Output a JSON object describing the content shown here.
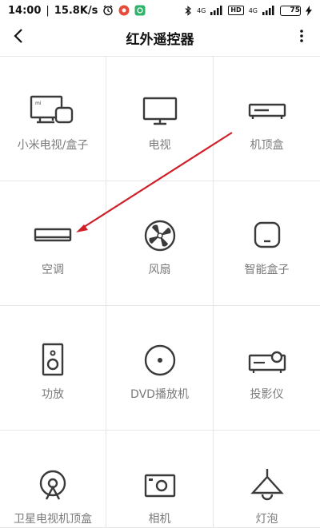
{
  "status_bar": {
    "time": "14:00",
    "net_speed": "15.8K/s",
    "tags": [
      "4G",
      "HD",
      "4G"
    ],
    "battery": "75",
    "battery_color": "#b7e44a"
  },
  "app_bar": {
    "title": "红外遥控器",
    "back_icon": "back-chevron-icon",
    "more_icon": "more-vertical-icon"
  },
  "devices": [
    {
      "label": "小米电视/盒子",
      "icon": "mi-tv-box-icon"
    },
    {
      "label": "电视",
      "icon": "tv-icon"
    },
    {
      "label": "机顶盒",
      "icon": "set-top-box-icon"
    },
    {
      "label": "空调",
      "icon": "air-conditioner-icon"
    },
    {
      "label": "风扇",
      "icon": "fan-icon"
    },
    {
      "label": "智能盒子",
      "icon": "smart-box-icon"
    },
    {
      "label": "功放",
      "icon": "amplifier-icon"
    },
    {
      "label": "DVD播放机",
      "icon": "dvd-player-icon"
    },
    {
      "label": "投影仪",
      "icon": "projector-icon"
    },
    {
      "label": "卫星电视机顶盒",
      "icon": "satellite-box-icon"
    },
    {
      "label": "相机",
      "icon": "camera-icon"
    },
    {
      "label": "灯泡",
      "icon": "light-bulb-icon"
    }
  ],
  "annotation": {
    "arrow_color": "#d0202a"
  }
}
